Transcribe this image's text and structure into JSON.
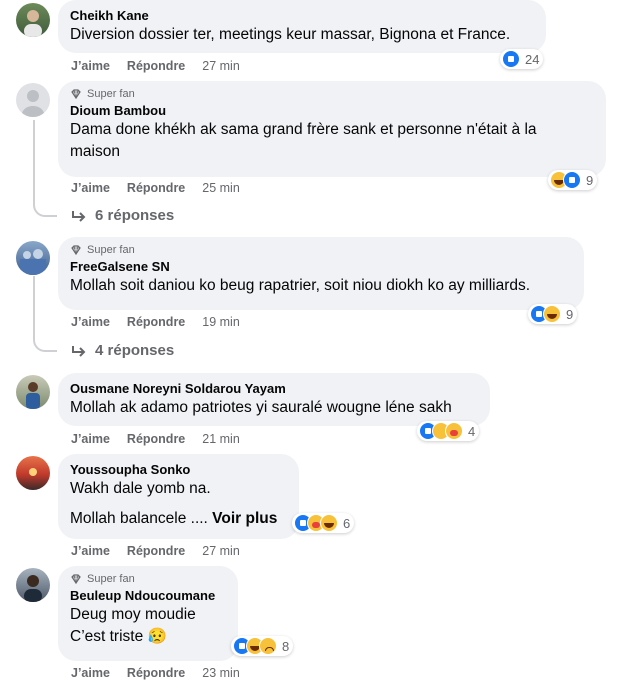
{
  "comments": [
    {
      "author": "Cheikh Kane",
      "badge": "",
      "lines": [
        "Diversion dossier ter, meetings keur massar, Bignona et France."
      ],
      "like_label": "J’aime",
      "reply_label": "Répondre",
      "time": "27 min",
      "reactions": [
        "like"
      ],
      "reaction_count": "24"
    },
    {
      "author": "Dioum Bambou",
      "badge": "Super fan",
      "lines": [
        "Dama done khékh ak sama grand frère sank et personne n'était à la",
        "maison"
      ],
      "like_label": "J’aime",
      "reply_label": "Répondre",
      "time": "25 min",
      "reactions": [
        "haha",
        "like"
      ],
      "reaction_count": "9",
      "replies": "6 réponses"
    },
    {
      "author": "FreeGalsene SN",
      "badge": "Super fan",
      "lines": [
        "Mollah soit daniou ko beug rapatrier, soit niou diokh ko ay milliards."
      ],
      "like_label": "J’aime",
      "reply_label": "Répondre",
      "time": "19 min",
      "reactions": [
        "like",
        "haha"
      ],
      "reaction_count": "9",
      "replies": "4 réponses"
    },
    {
      "author": "Ousmane Noreyni Soldarou Yayam",
      "badge": "",
      "lines": [
        "Mollah ak adamo patriotes yi sauralé wougne léne sakh"
      ],
      "like_label": "J’aime",
      "reply_label": "Répondre",
      "time": "21 min",
      "reactions": [
        "like",
        "wow",
        "care"
      ],
      "reaction_count": "4"
    },
    {
      "author": "Youssoupha Sonko",
      "badge": "",
      "lines": [
        "Wakh dale yomb na.",
        "Mollah balancele ...."
      ],
      "see_more": "Voir plus",
      "like_label": "J’aime",
      "reply_label": "Répondre",
      "time": "27 min",
      "reactions": [
        "like",
        "care",
        "haha"
      ],
      "reaction_count": "6"
    },
    {
      "author": "Beuleup Ndoucoumane",
      "badge": "Super fan",
      "lines": [
        "Deug moy moudie",
        "C’est triste 😥"
      ],
      "like_label": "J’aime",
      "reply_label": "Répondre",
      "time": "23 min",
      "reactions": [
        "like",
        "haha",
        "sad"
      ],
      "reaction_count": "8"
    }
  ],
  "colors": {
    "bubble": "#f0f2f5",
    "secondary_text": "#65676b",
    "like_blue": "#1877f2"
  }
}
